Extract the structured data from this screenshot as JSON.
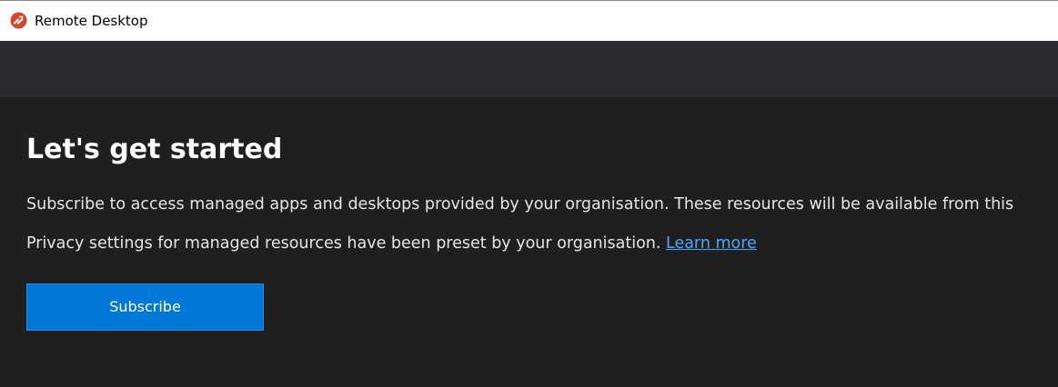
{
  "window": {
    "title": "Remote Desktop",
    "icon": "remote-desktop-icon"
  },
  "main": {
    "heading": "Let's get started",
    "description": "Subscribe to access managed apps and desktops provided by your organisation. These resources will be available from this",
    "privacy_text": "Privacy settings for managed resources have been preset by your organisation. ",
    "learn_more_label": "Learn more",
    "subscribe_label": "Subscribe"
  },
  "colors": {
    "titlebar_bg": "#ffffff",
    "header_band_bg": "#2b2a2d",
    "content_bg": "#1f1f1f",
    "accent": "#0078d7",
    "link": "#4ea6ff",
    "icon_red": "#d4462b"
  }
}
